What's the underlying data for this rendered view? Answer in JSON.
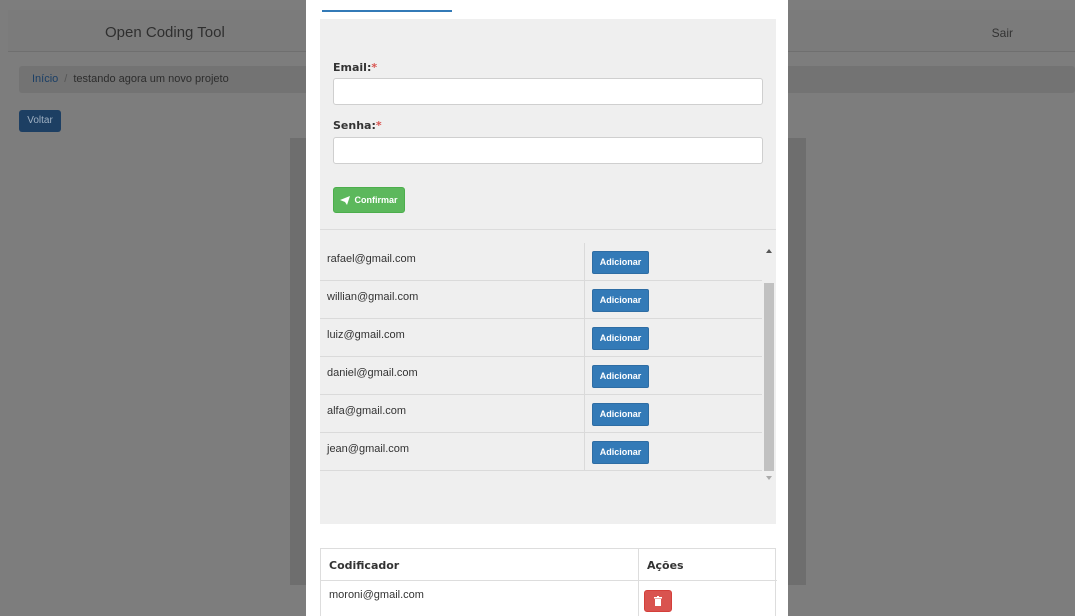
{
  "app": {
    "brand": "Open Coding Tool",
    "logout_label": "Sair"
  },
  "breadcrumb": {
    "home": "Início",
    "separator": "/",
    "current": "testando agora um novo projeto"
  },
  "back_label": "Voltar",
  "form": {
    "email_label": "Email:",
    "password_label": "Senha:",
    "required_mark": "*",
    "email_value": "",
    "password_value": "",
    "confirm_label": "Confirmar",
    "confirm_icon": "paper-plane-icon"
  },
  "users": [
    {
      "email": "rafael@gmail.com",
      "action": "Adicionar"
    },
    {
      "email": "willian@gmail.com",
      "action": "Adicionar"
    },
    {
      "email": "luiz@gmail.com",
      "action": "Adicionar"
    },
    {
      "email": "daniel@gmail.com",
      "action": "Adicionar"
    },
    {
      "email": "alfa@gmail.com",
      "action": "Adicionar"
    },
    {
      "email": "jean@gmail.com",
      "action": "Adicionar"
    }
  ],
  "coders_table": {
    "headers": [
      "Codificador",
      "Ações"
    ],
    "rows": [
      {
        "email": "moroni@gmail.com",
        "action_icon": "trash-icon"
      }
    ]
  },
  "colors": {
    "primary": "#337ab7",
    "success": "#5cb85c",
    "danger": "#d9534f"
  }
}
